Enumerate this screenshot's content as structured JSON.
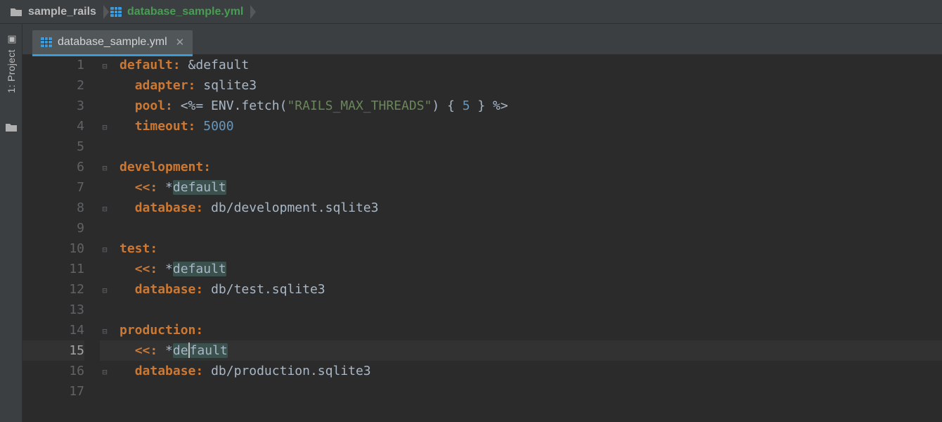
{
  "breadcrumb": {
    "items": [
      {
        "icon": "folder",
        "label": "sample_rails"
      },
      {
        "icon": "table",
        "label": "database_sample.yml",
        "active": true
      }
    ]
  },
  "tool_strip": {
    "tab_label": "1: Project",
    "bottom_icon": "folder"
  },
  "tabs": [
    {
      "icon": "table",
      "label": "database_sample.yml",
      "active": true
    }
  ],
  "gutter": {
    "start": 1,
    "end": 17
  },
  "current_line": 15,
  "code": {
    "lines": [
      {
        "n": 1,
        "fold": "open",
        "segments": [
          {
            "t": "default:",
            "c": "key"
          },
          {
            "t": " ",
            "c": "text"
          },
          {
            "t": "&default",
            "c": "anchor"
          }
        ]
      },
      {
        "n": 2,
        "fold": "",
        "indent": 1,
        "segments": [
          {
            "t": "adapter:",
            "c": "key"
          },
          {
            "t": " sqlite3",
            "c": "text"
          }
        ]
      },
      {
        "n": 3,
        "fold": "",
        "indent": 1,
        "segments": [
          {
            "t": "pool:",
            "c": "key"
          },
          {
            "t": " <%= ENV.fetch(",
            "c": "text"
          },
          {
            "t": "\"RAILS_MAX_THREADS\"",
            "c": "str"
          },
          {
            "t": ") { ",
            "c": "text"
          },
          {
            "t": "5",
            "c": "num"
          },
          {
            "t": " } %>",
            "c": "text"
          }
        ]
      },
      {
        "n": 4,
        "fold": "close",
        "indent": 1,
        "segments": [
          {
            "t": "timeout:",
            "c": "key"
          },
          {
            "t": " ",
            "c": "text"
          },
          {
            "t": "5000",
            "c": "num"
          }
        ]
      },
      {
        "n": 5,
        "fold": "",
        "segments": []
      },
      {
        "n": 6,
        "fold": "open",
        "segments": [
          {
            "t": "development:",
            "c": "key"
          }
        ]
      },
      {
        "n": 7,
        "fold": "",
        "indent": 1,
        "segments": [
          {
            "t": "<<:",
            "c": "key"
          },
          {
            "t": " *",
            "c": "text"
          },
          {
            "t": "default",
            "c": "text",
            "hl": true
          }
        ]
      },
      {
        "n": 8,
        "fold": "close",
        "indent": 1,
        "segments": [
          {
            "t": "database:",
            "c": "key"
          },
          {
            "t": " db/development.sqlite3",
            "c": "text"
          }
        ]
      },
      {
        "n": 9,
        "fold": "",
        "segments": []
      },
      {
        "n": 10,
        "fold": "open",
        "segments": [
          {
            "t": "test:",
            "c": "key"
          }
        ]
      },
      {
        "n": 11,
        "fold": "",
        "indent": 1,
        "segments": [
          {
            "t": "<<:",
            "c": "key"
          },
          {
            "t": " *",
            "c": "text"
          },
          {
            "t": "default",
            "c": "text",
            "hl": true
          }
        ]
      },
      {
        "n": 12,
        "fold": "close",
        "indent": 1,
        "segments": [
          {
            "t": "database:",
            "c": "key"
          },
          {
            "t": " db/test.sqlite3",
            "c": "text"
          }
        ]
      },
      {
        "n": 13,
        "fold": "",
        "segments": []
      },
      {
        "n": 14,
        "fold": "open",
        "segments": [
          {
            "t": "production:",
            "c": "key"
          }
        ]
      },
      {
        "n": 15,
        "fold": "",
        "indent": 1,
        "current": true,
        "caret_after": 2,
        "segments": [
          {
            "t": "<<:",
            "c": "key"
          },
          {
            "t": " *",
            "c": "text"
          },
          {
            "t": "de",
            "c": "text",
            "hl": true
          },
          {
            "t": "fault",
            "c": "text",
            "hl": true
          }
        ]
      },
      {
        "n": 16,
        "fold": "close",
        "indent": 1,
        "segments": [
          {
            "t": "database:",
            "c": "key"
          },
          {
            "t": " db/production.sqlite3",
            "c": "text"
          }
        ]
      },
      {
        "n": 17,
        "fold": "",
        "segments": []
      }
    ]
  }
}
